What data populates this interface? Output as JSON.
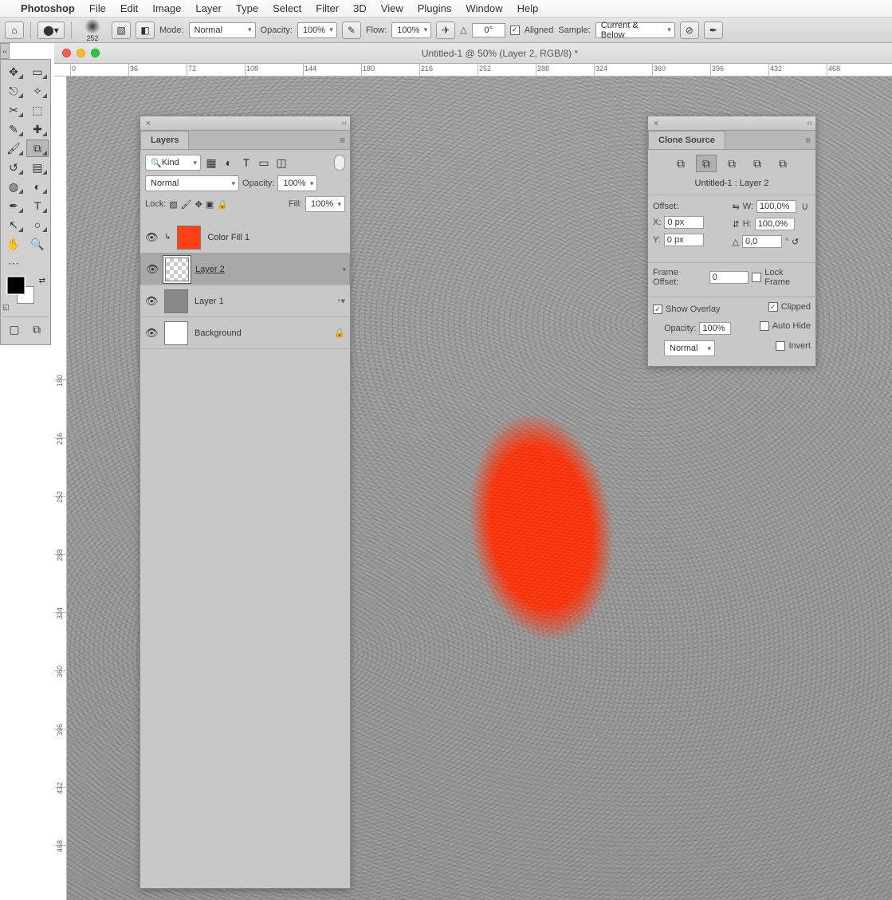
{
  "menubar": {
    "app": "Photoshop",
    "items": [
      "File",
      "Edit",
      "Image",
      "Layer",
      "Type",
      "Select",
      "Filter",
      "3D",
      "View",
      "Plugins",
      "Window",
      "Help"
    ]
  },
  "optbar": {
    "brush_size": "252",
    "mode_label": "Mode:",
    "mode_value": "Normal",
    "opacity_label": "Opacity:",
    "opacity_value": "100%",
    "flow_label": "Flow:",
    "flow_value": "100%",
    "angle_value": "0°",
    "aligned_label": "Aligned",
    "sample_label": "Sample:",
    "sample_value": "Current & Below"
  },
  "window_title": "Untitled-1 @ 50% (Layer 2, RGB/8) *",
  "ruler_h": [
    "0",
    "36",
    "72",
    "108",
    "144",
    "180",
    "216",
    "252",
    "288",
    "324",
    "360",
    "396",
    "432",
    "468"
  ],
  "ruler_v": [
    "180",
    "216",
    "252",
    "288",
    "324",
    "360",
    "396",
    "432",
    "468"
  ],
  "layers_panel": {
    "title": "Layers",
    "kind": "Kind",
    "blend": "Normal",
    "opacity_label": "Opacity:",
    "opacity_value": "100%",
    "lock_label": "Lock:",
    "fill_label": "Fill:",
    "fill_value": "100%",
    "layers": [
      {
        "name": "Color Fill 1",
        "thumb": "orange",
        "selected": false,
        "clip": true
      },
      {
        "name": "Layer 2",
        "thumb": "checker",
        "selected": true,
        "underline": true
      },
      {
        "name": "Layer 1",
        "thumb": "gray",
        "selected": false,
        "smart": true
      },
      {
        "name": "Background",
        "thumb": "white",
        "selected": false,
        "locked": true
      }
    ]
  },
  "clone_panel": {
    "title": "Clone Source",
    "source_name": "Untitled-1 : Layer 2",
    "offset_label": "Offset:",
    "x_label": "X:",
    "x_value": "0 px",
    "y_label": "Y:",
    "y_value": "0 px",
    "w_label": "W:",
    "w_value": "100,0%",
    "h_label": "H:",
    "h_value": "100,0%",
    "angle_value": "0,0",
    "frame_label": "Frame Offset:",
    "frame_value": "0",
    "lock_frame": "Lock Frame",
    "show_overlay": "Show Overlay",
    "clipped": "Clipped",
    "autohide": "Auto Hide",
    "invert": "Invert",
    "ov_opacity_label": "Opacity:",
    "ov_opacity_value": "100%",
    "ov_blend": "Normal"
  }
}
